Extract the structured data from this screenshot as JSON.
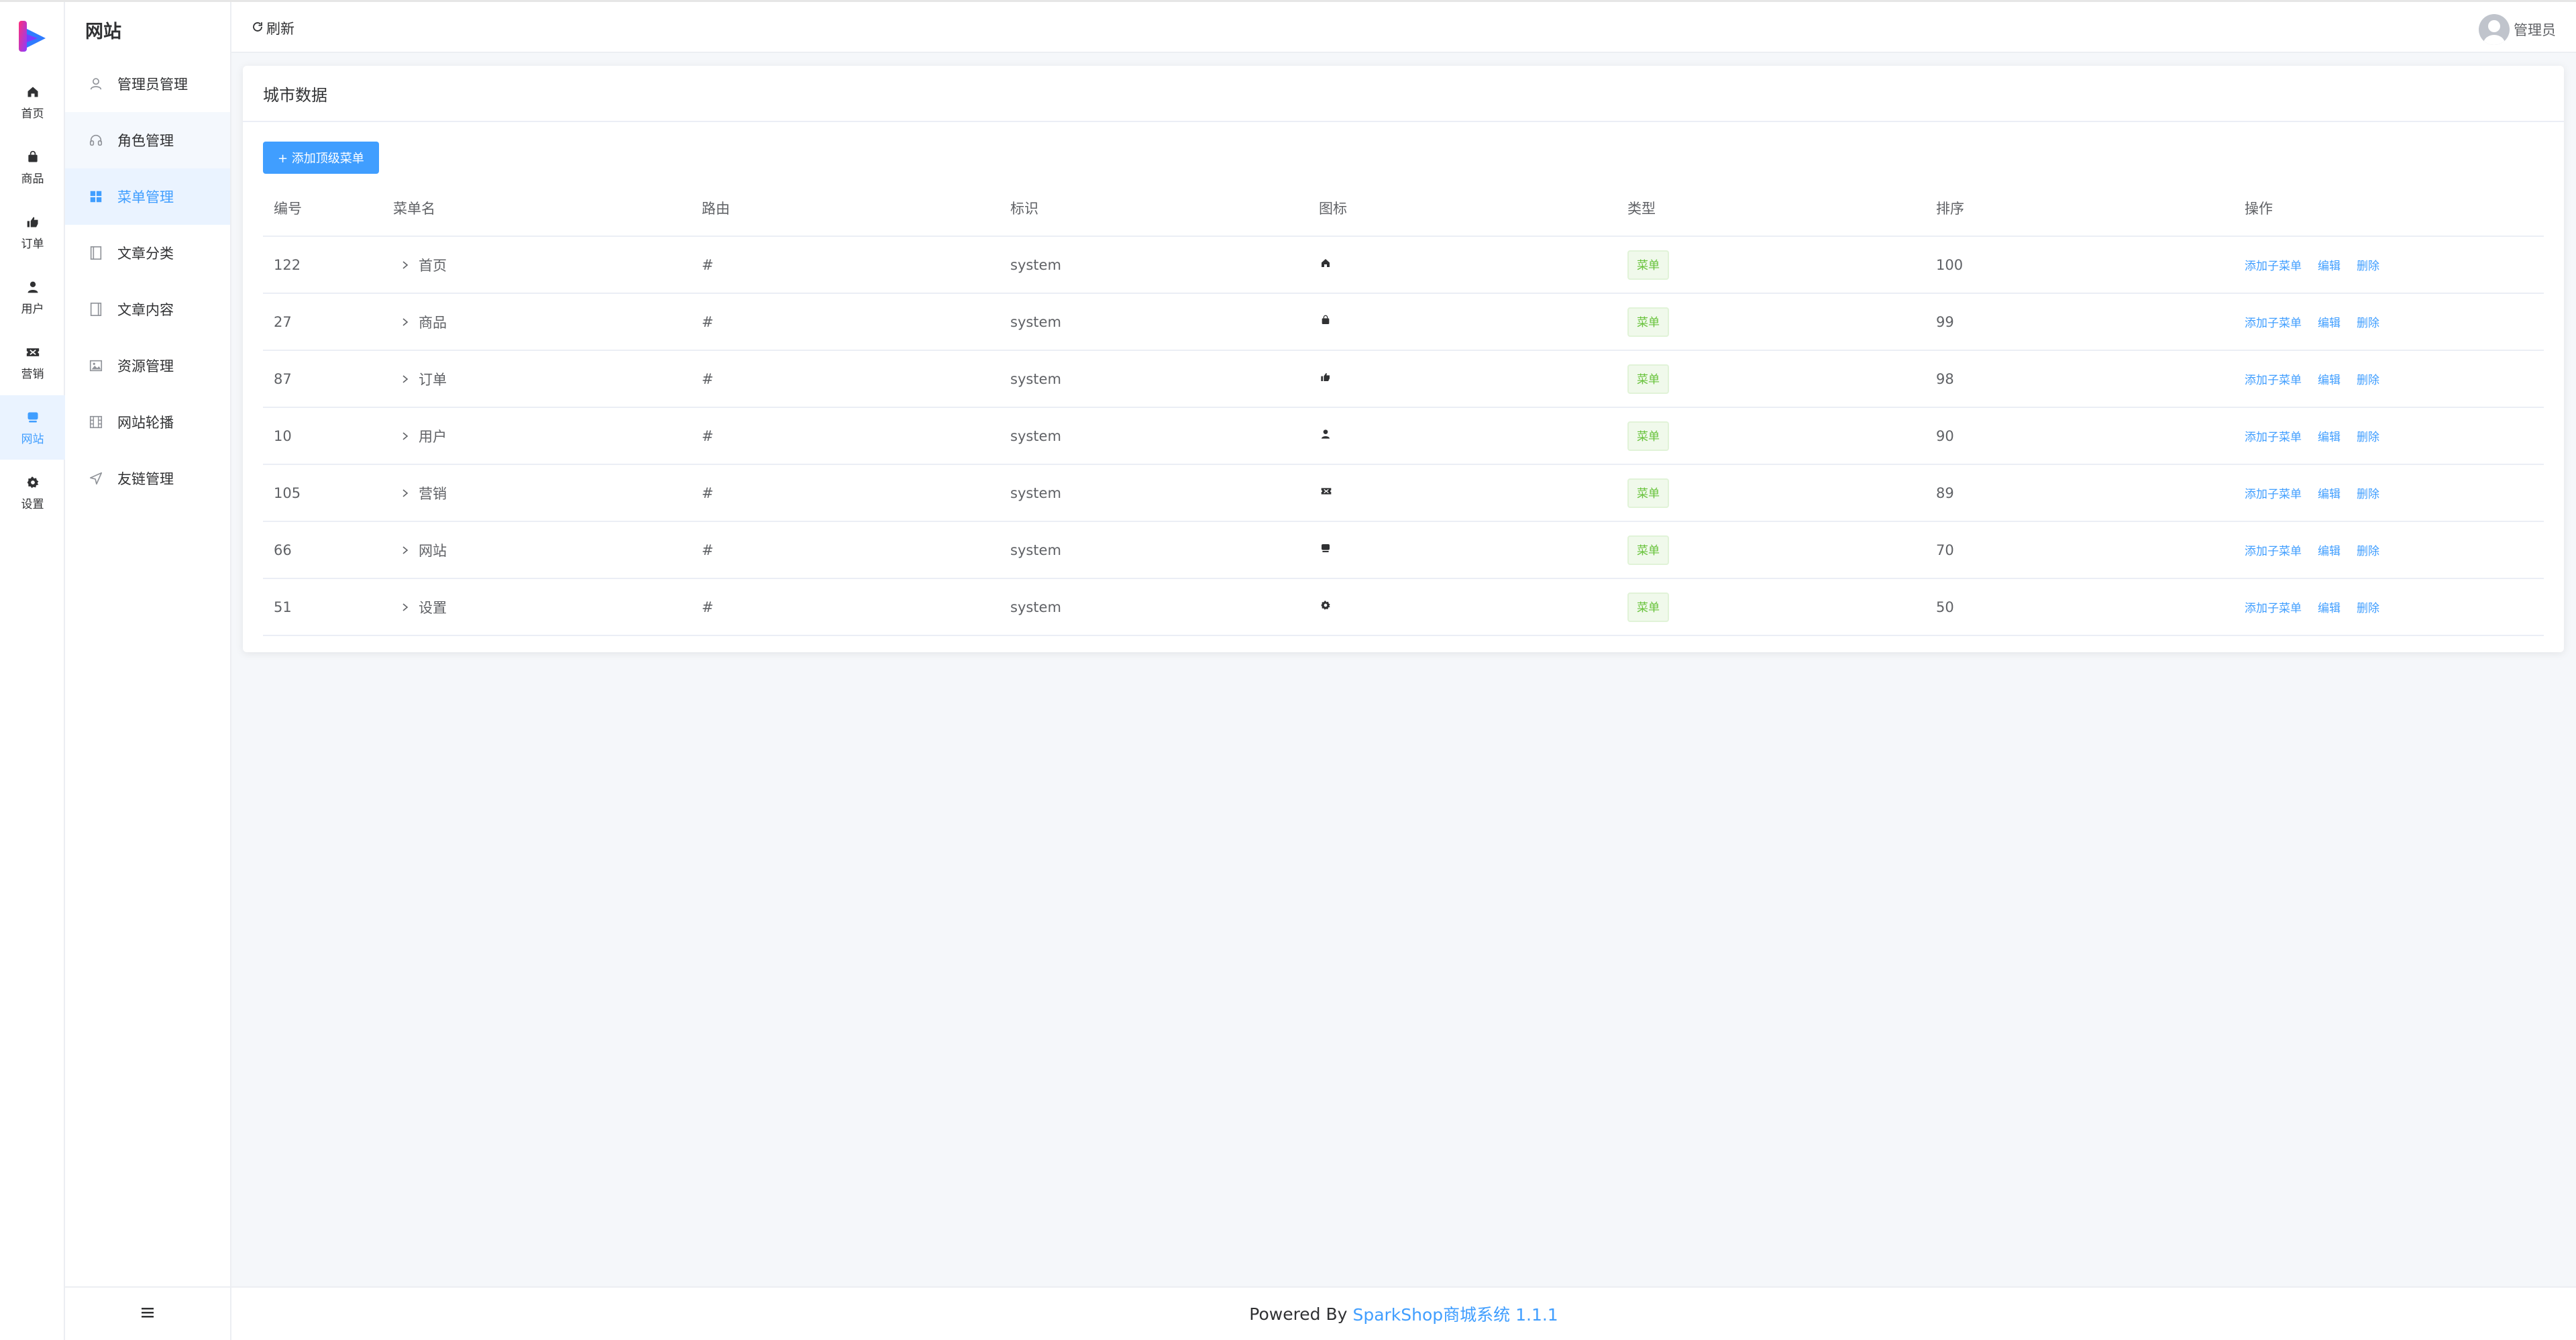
{
  "rail": {
    "items": [
      {
        "label": "首页",
        "icon": "home-icon"
      },
      {
        "label": "商品",
        "icon": "bag-icon"
      },
      {
        "label": "订单",
        "icon": "order-icon"
      },
      {
        "label": "用户",
        "icon": "user-icon"
      },
      {
        "label": "营销",
        "icon": "ticket-icon"
      },
      {
        "label": "网站",
        "icon": "website-icon"
      },
      {
        "label": "设置",
        "icon": "gear-icon"
      }
    ],
    "active_index": 5
  },
  "submenu": {
    "title": "网站",
    "items": [
      {
        "label": "管理员管理",
        "icon": "user-outline-icon"
      },
      {
        "label": "角色管理",
        "icon": "headset-icon"
      },
      {
        "label": "菜单管理",
        "icon": "grid-icon"
      },
      {
        "label": "文章分类",
        "icon": "document-icon"
      },
      {
        "label": "文章内容",
        "icon": "notebook-icon"
      },
      {
        "label": "资源管理",
        "icon": "picture-icon"
      },
      {
        "label": "网站轮播",
        "icon": "film-icon"
      },
      {
        "label": "友链管理",
        "icon": "send-icon"
      }
    ],
    "active_index": 2
  },
  "header": {
    "refresh_label": "刷新",
    "user_name": "管理员"
  },
  "card": {
    "title": "城市数据",
    "add_button_label": "+ 添加顶级菜单"
  },
  "table": {
    "columns": [
      "编号",
      "菜单名",
      "路由",
      "标识",
      "图标",
      "类型",
      "排序",
      "操作"
    ],
    "rows": [
      {
        "id": "122",
        "name": "首页",
        "route": "#",
        "tag": "system",
        "icon": "home-icon",
        "type": "菜单",
        "sort": "100"
      },
      {
        "id": "27",
        "name": "商品",
        "route": "#",
        "tag": "system",
        "icon": "bag-icon",
        "type": "菜单",
        "sort": "99"
      },
      {
        "id": "87",
        "name": "订单",
        "route": "#",
        "tag": "system",
        "icon": "order-icon",
        "type": "菜单",
        "sort": "98"
      },
      {
        "id": "10",
        "name": "用户",
        "route": "#",
        "tag": "system",
        "icon": "user-icon",
        "type": "菜单",
        "sort": "90"
      },
      {
        "id": "105",
        "name": "营销",
        "route": "#",
        "tag": "system",
        "icon": "ticket-icon",
        "type": "菜单",
        "sort": "89"
      },
      {
        "id": "66",
        "name": "网站",
        "route": "#",
        "tag": "system",
        "icon": "website-icon",
        "type": "菜单",
        "sort": "70"
      },
      {
        "id": "51",
        "name": "设置",
        "route": "#",
        "tag": "system",
        "icon": "gear-icon",
        "type": "菜单",
        "sort": "50"
      }
    ],
    "actions": {
      "add_child": "添加子菜单",
      "edit": "编辑",
      "delete": "删除"
    }
  },
  "footer": {
    "prefix": "Powered By",
    "link_text": "SparkShop商城系统 1.1.1"
  },
  "colors": {
    "accent": "#409eff",
    "success": "#67c23a",
    "active_bg": "#eaf3ff"
  }
}
